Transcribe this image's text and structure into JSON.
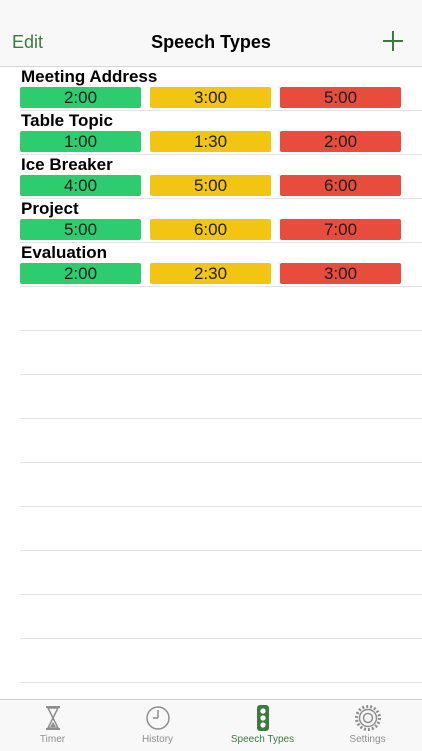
{
  "navbar": {
    "edit_label": "Edit",
    "title": "Speech Types",
    "add_icon": "plus-icon"
  },
  "colors": {
    "green": "#2dcc6f",
    "yellow": "#f2c513",
    "red": "#e74c3c",
    "accent": "#3c7a42"
  },
  "speech_types": [
    {
      "name": "Meeting Address",
      "green": "2:00",
      "yellow": "3:00",
      "red": "5:00"
    },
    {
      "name": "Table Topic",
      "green": "1:00",
      "yellow": "1:30",
      "red": "2:00"
    },
    {
      "name": "Ice Breaker",
      "green": "4:00",
      "yellow": "5:00",
      "red": "6:00"
    },
    {
      "name": "Project",
      "green": "5:00",
      "yellow": "6:00",
      "red": "7:00"
    },
    {
      "name": "Evaluation",
      "green": "2:00",
      "yellow": "2:30",
      "red": "3:00"
    }
  ],
  "tabbar": {
    "tabs": [
      {
        "label": "Timer",
        "icon": "hourglass-icon"
      },
      {
        "label": "History",
        "icon": "clock-icon"
      },
      {
        "label": "Speech Types",
        "icon": "traffic-light-icon",
        "active": true
      },
      {
        "label": "Settings",
        "icon": "gear-icon"
      }
    ]
  }
}
